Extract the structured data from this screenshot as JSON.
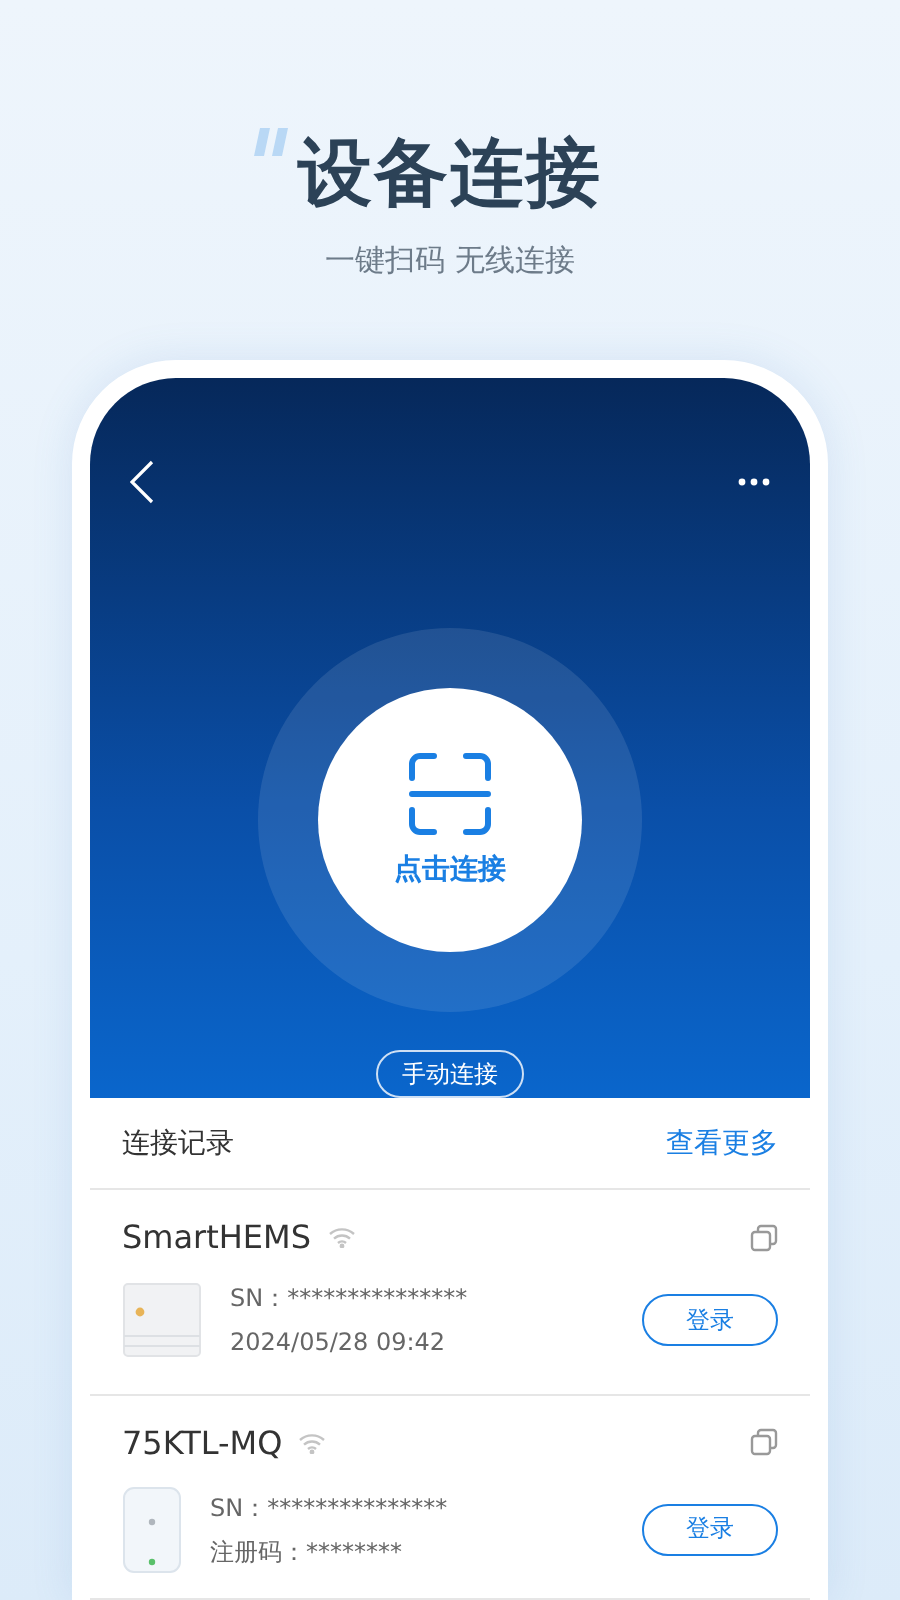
{
  "headline": "设备连接",
  "subtitle": "一键扫码 无线连接",
  "screen": {
    "scan_label": "点击连接",
    "manual_button": "手动连接",
    "records_title": "连接记录",
    "more_link": "查看更多",
    "records": [
      {
        "name": "SmartHEMS",
        "kind": "box",
        "lines": [
          "SN：***************",
          "2024/05/28 09:42"
        ],
        "login": "登录"
      },
      {
        "name": "75KTL-MQ",
        "kind": "plug",
        "lines": [
          "SN：***************",
          "注册码：********"
        ],
        "login": "登录"
      }
    ]
  }
}
